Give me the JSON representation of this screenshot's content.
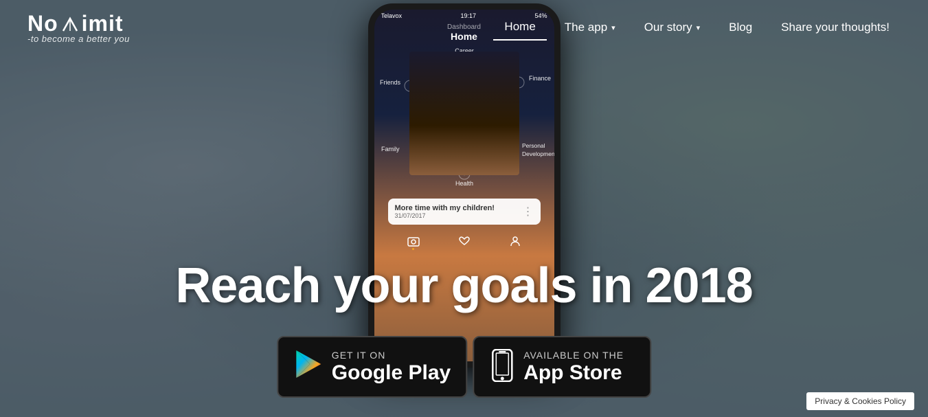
{
  "logo": {
    "text_before": "No",
    "text_after": "imit",
    "tagline": "-to become a better you"
  },
  "nav": {
    "home_label": "Home",
    "app_label": "The app",
    "story_label": "Our story",
    "blog_label": "Blog",
    "share_label": "Share your thoughts!"
  },
  "hero": {
    "title": "Reach your goals in 2018"
  },
  "google_play": {
    "get_it": "GET IT ON",
    "store_name": "Google Play"
  },
  "app_store": {
    "available": "Available on the",
    "store_name": "App Store"
  },
  "phone": {
    "carrier": "Telavox",
    "time": "19:17",
    "battery": "54%",
    "dashboard_label": "Dashboard",
    "home_label": "Home",
    "goal_title": "More time with my children!",
    "goal_date": "31/07/2017",
    "radar_labels": [
      "Career",
      "Finance",
      "Personal Development",
      "Health",
      "Family",
      "Friends"
    ]
  },
  "privacy": {
    "label": "Privacy & Cookies Policy"
  },
  "colors": {
    "accent": "#f5a623",
    "bg_dark": "#111111",
    "nav_text": "#ffffff",
    "hero_text": "#ffffff"
  }
}
